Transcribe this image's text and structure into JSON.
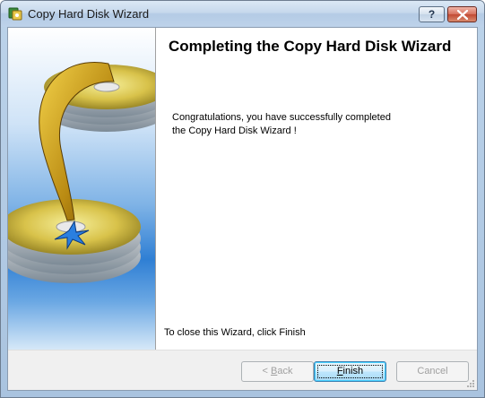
{
  "window": {
    "title": "Copy Hard Disk Wizard"
  },
  "titlebar_buttons": {
    "help": "?",
    "close_icon": "close-icon"
  },
  "content": {
    "heading": "Completing the Copy Hard Disk Wizard",
    "body_line1": "Congratulations, you have successfully completed",
    "body_line2": "the Copy Hard Disk Wizard !",
    "close_hint": "To close this Wizard, click Finish"
  },
  "buttons": {
    "back_prefix": "< ",
    "back_accel": "B",
    "back_rest": "ack",
    "finish_accel": "F",
    "finish_rest": "inish",
    "cancel": "Cancel"
  },
  "colors": {
    "titlebar": "#c6d8ec",
    "close_button": "#c24a33",
    "disc_gold": "#d8c24a",
    "side_blue": "#2f7fd4"
  }
}
